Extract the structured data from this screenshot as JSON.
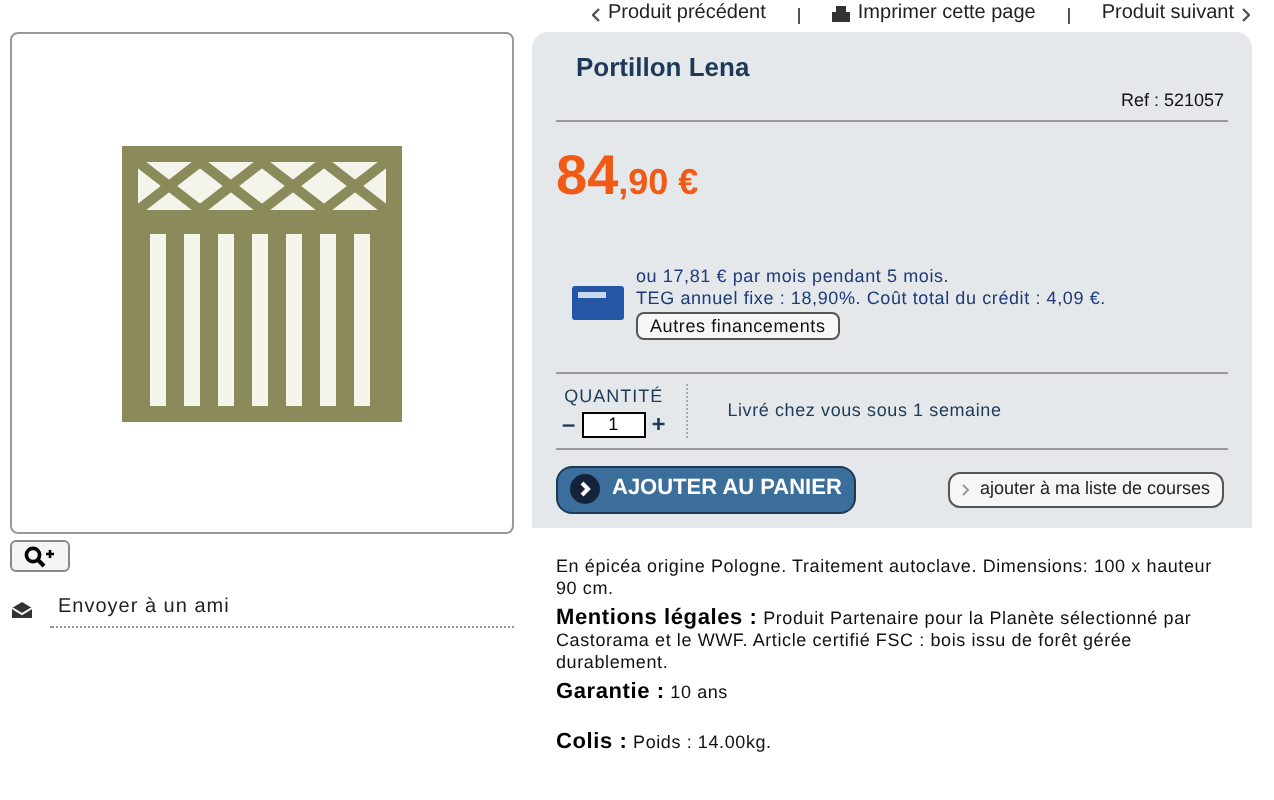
{
  "nav": [
    {
      "kind": "prev",
      "label": "Produit précédent"
    },
    {
      "kind": "print",
      "label": "Imprimer cette page"
    },
    {
      "kind": "next",
      "label": "Produit suivant"
    }
  ],
  "product": {
    "title": "Portillon Lena",
    "ref": "Ref : 521057",
    "price_main": "84",
    "price_cents": ",90 €"
  },
  "credit": {
    "line_1": "ou 17,81 € par mois pendant 5 mois.",
    "line_2": "TEG annuel fixe : 18,90%. Coût total du crédit : 4,09 €.",
    "button": "Autres financements"
  },
  "quantity": {
    "label": "QUANTITÉ",
    "minus": "–",
    "value": "1",
    "plus": "+"
  },
  "delivery": "Livré chez vous sous 1 semaine",
  "add_to_cart": "AJOUTER AU PANIER",
  "add_to_list": "ajouter à ma liste de courses",
  "send_to_friend": "Envoyer à un ami",
  "description": "En épicéa origine Pologne. Traitement autoclave. Dimensions: 100 x hauteur 90 cm.",
  "details": [
    {
      "label": "Mentions légales :",
      "text": "Produit Partenaire pour la Planète sélectionné par Castorama et le WWF. Article certifié FSC : bois issu de forêt gérée durablement."
    },
    {
      "label": "Garantie :",
      "text": "10 ans"
    },
    {
      "label": "Colis :",
      "text": "Poids : 14.00kg."
    }
  ]
}
